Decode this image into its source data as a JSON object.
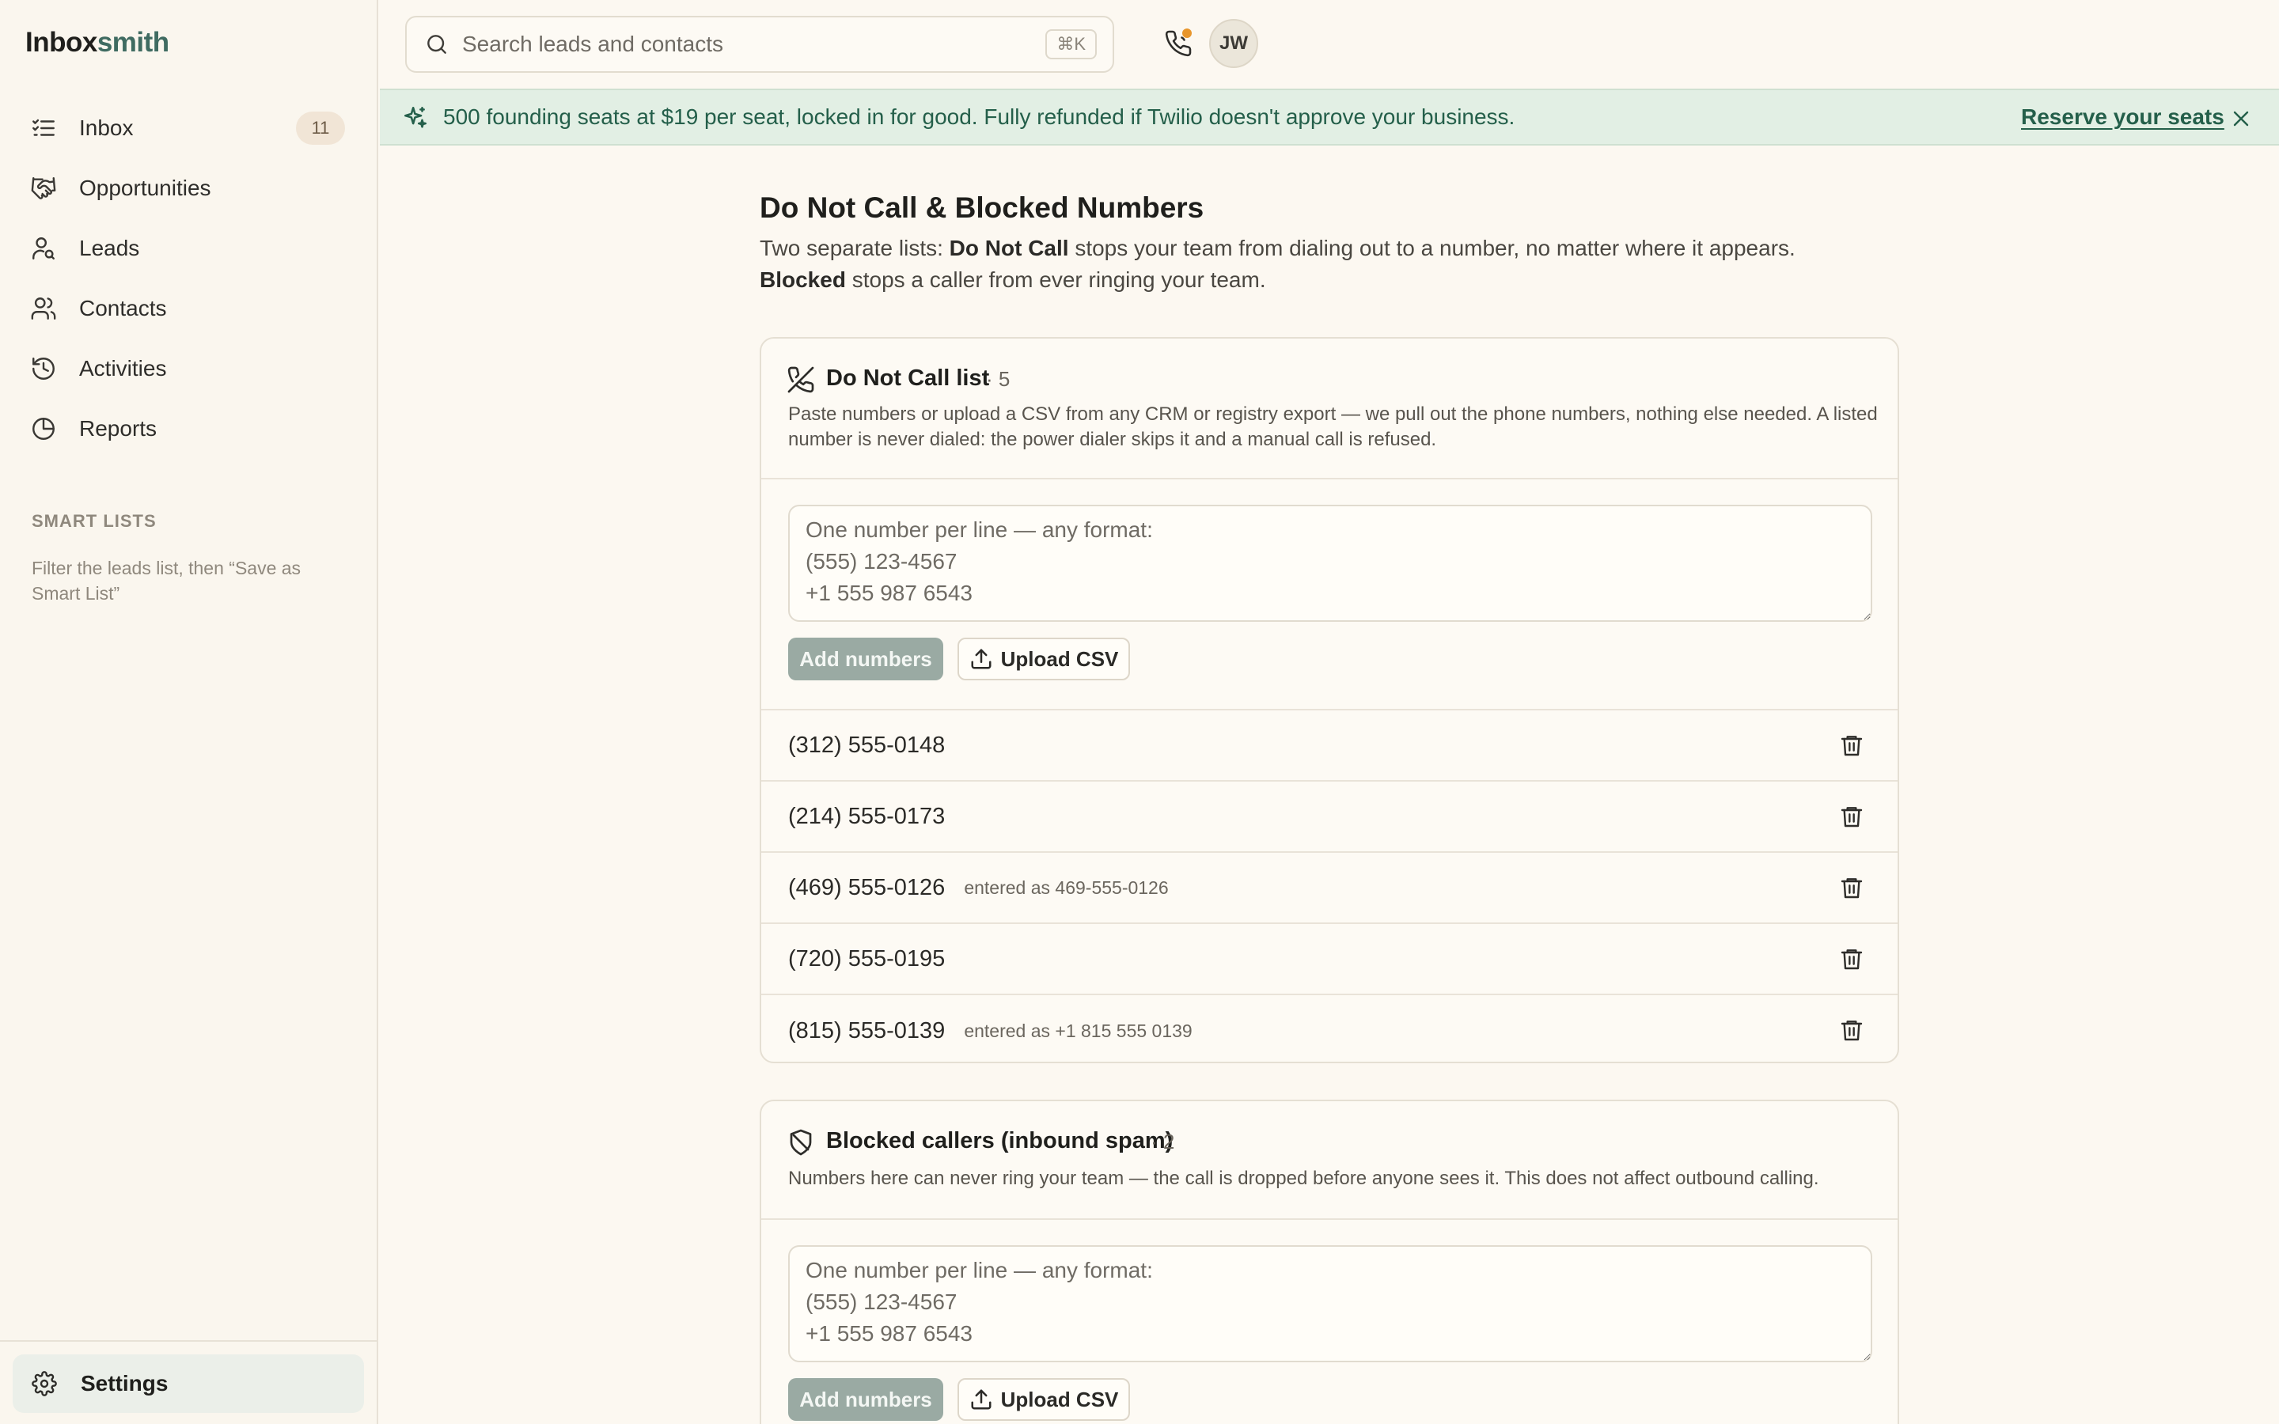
{
  "app": {
    "brand_main": "Inbox",
    "brand_accent": "smith"
  },
  "sidebar": {
    "items": [
      {
        "label": "Inbox",
        "icon": "inbox-list-icon",
        "badge": "11"
      },
      {
        "label": "Opportunities",
        "icon": "handshake-icon"
      },
      {
        "label": "Leads",
        "icon": "user-search-icon"
      },
      {
        "label": "Contacts",
        "icon": "users-icon"
      },
      {
        "label": "Activities",
        "icon": "history-icon"
      },
      {
        "label": "Reports",
        "icon": "pie-chart-icon"
      }
    ],
    "smart_lists_heading": "SMART LISTS",
    "smart_lists_hint": "Filter the leads list, then “Save as Smart List”",
    "settings_label": "Settings"
  },
  "topbar": {
    "search_placeholder": "Search leads and contacts",
    "search_shortcut": "⌘K",
    "avatar_initials": "JW"
  },
  "banner": {
    "text": "500 founding seats at $19 per seat, locked in for good. Fully refunded if Twilio doesn't approve your business.",
    "link": "Reserve your seats"
  },
  "page": {
    "title": "Do Not Call & Blocked Numbers",
    "desc_1": "Two separate lists: ",
    "desc_bold_1": "Do Not Call",
    "desc_2": " stops your team from dialing out to a number, no matter where it appears. ",
    "desc_bold_2": "Blocked",
    "desc_3": " stops a caller from ever ringing your team."
  },
  "dnc": {
    "title": "Do Not Call list",
    "count": "· 5",
    "description": "Paste numbers or upload a CSV from any CRM or registry export — we pull out the phone numbers, nothing else needed. A listed number is never dialed: the power dialer skips it and a manual call is refused.",
    "placeholder": "One number per line — any format:\n(555) 123-4567\n+1 555 987 6543",
    "add_label": "Add numbers",
    "upload_label": "Upload CSV",
    "numbers": [
      {
        "number": "(312) 555-0148",
        "entered": ""
      },
      {
        "number": "(214) 555-0173",
        "entered": ""
      },
      {
        "number": "(469) 555-0126",
        "entered": "entered as 469-555-0126"
      },
      {
        "number": "(720) 555-0195",
        "entered": ""
      },
      {
        "number": "(815) 555-0139",
        "entered": "entered as +1 815 555 0139"
      }
    ]
  },
  "blocked": {
    "title": "Blocked callers (inbound spam)",
    "count": "· 2",
    "description": "Numbers here can never ring your team — the call is dropped before anyone sees it. This does not affect outbound calling.",
    "placeholder": "One number per line — any format:\n(555) 123-4567\n+1 555 987 6543",
    "add_label": "Add numbers",
    "upload_label": "Upload CSV"
  },
  "colors": {
    "accent": "#3f6b61",
    "banner_bg": "#e2efe4",
    "banner_text": "#245f4a",
    "badge_bg": "#f1e5d6",
    "notification_dot": "#e8962c"
  }
}
